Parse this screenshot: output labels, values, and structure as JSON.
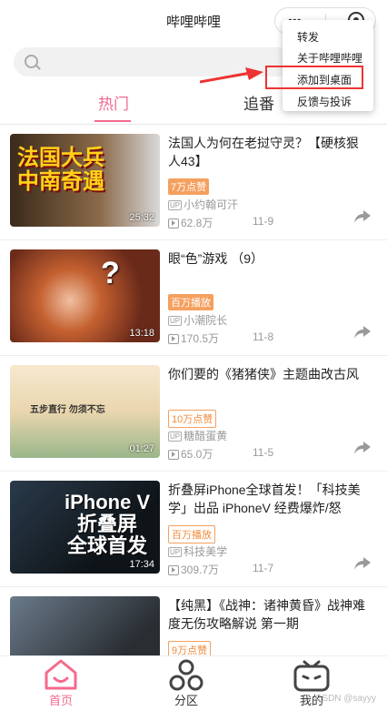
{
  "header": {
    "title": "哔哩哔哩"
  },
  "search": {
    "placeholder": ""
  },
  "tabs": [
    {
      "label": "热门"
    },
    {
      "label": "追番"
    }
  ],
  "menu": {
    "items": [
      "转发",
      "关于哔哩哔哩",
      "添加到桌面",
      "反馈与投诉"
    ],
    "highlighted_index": 2
  },
  "videos": [
    {
      "title": "法国人为何在老挝守灵？【硬核狠人43】",
      "badge": "7万点赞",
      "badge_style": "filled",
      "up": "小约翰可汗",
      "views": "62.8万",
      "date": "11-9",
      "duration": "25:32",
      "thumb_text": "法国大兵\n中南奇遇"
    },
    {
      "title": "眼“色”游戏 （9）",
      "badge": "百万播放",
      "badge_style": "filled",
      "up": "小潮院长",
      "views": "170.5万",
      "date": "11-8",
      "duration": "13:18",
      "thumb_text": "?"
    },
    {
      "title": "你们要的《猪猪侠》主题曲改古风",
      "badge": "10万点赞",
      "badge_style": "outline",
      "up": "糖醋蛋黄",
      "views": "65.0万",
      "date": "11-5",
      "duration": "01:27",
      "thumb_text": "五步直行 勿须不忘"
    },
    {
      "title": "折叠屏iPhone全球首发！「科技美学」出品 iPhoneV 经费爆炸/怒肝…",
      "badge": "百万播放",
      "badge_style": "outline",
      "up": "科技美学",
      "views": "309.7万",
      "date": "11-7",
      "duration": "17:34",
      "thumb_text": "iPhone V\n折叠屏\n全球首发"
    },
    {
      "title": "【纯黑】《战神：诸神黄昏》战神难度无伤攻略解说 第一期",
      "badge": "9万点赞",
      "badge_style": "outline",
      "up": "",
      "views": "",
      "date": "",
      "duration": "",
      "thumb_text": ""
    }
  ],
  "up_tag": "UP",
  "bottom_nav": [
    {
      "label": "首页",
      "active": true
    },
    {
      "label": "分区",
      "active": false
    },
    {
      "label": "我的",
      "active": false
    }
  ],
  "watermark": "CSDN @sayyy",
  "colors": {
    "accent": "#f36a8d",
    "badge": "#f5a05f",
    "highlight": "#e33333"
  }
}
